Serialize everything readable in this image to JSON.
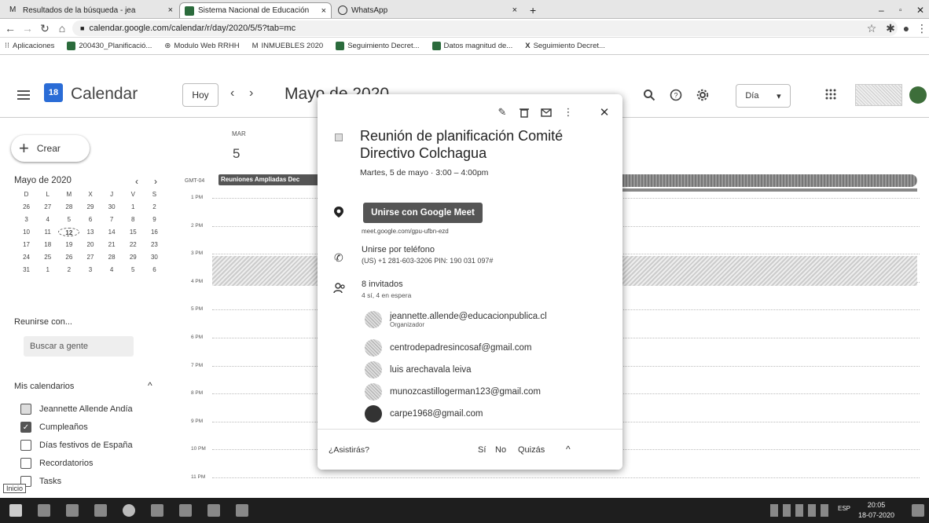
{
  "browser": {
    "tabs": [
      {
        "label": "Resultados de la búsqueda - jea",
        "close": "×"
      },
      {
        "label": "Sistema Nacional de Educación",
        "close": "×"
      },
      {
        "label": "WhatsApp",
        "close": "×"
      }
    ],
    "new_tab": "+",
    "url": "calendar.google.com/calendar/r/day/2020/5/5?tab=mc",
    "bookmarks": [
      "Aplicaciones",
      "200430_Planificació...",
      "Modulo Web RRHH",
      "INMUEBLES 2020",
      "Seguimiento Decret...",
      "Datos magnitud de...",
      "Seguimiento Decret..."
    ]
  },
  "header": {
    "logo_day": "18",
    "title": "Calendar",
    "today": "Hoy",
    "prev": "‹",
    "next": "›",
    "month": "Mayo de 2020",
    "view": "Día",
    "view_caret": "▾"
  },
  "sidebar": {
    "create": "Crear",
    "mini_month": "Mayo de 2020",
    "mini_prev": "‹",
    "mini_next": "›",
    "mini_days": [
      "D",
      "L",
      "M",
      "X",
      "J",
      "V",
      "S",
      "26",
      "27",
      "28",
      "29",
      "30",
      "1",
      "2",
      "3",
      "4",
      "5",
      "6",
      "7",
      "8",
      "9",
      "10",
      "11",
      "12",
      "13",
      "14",
      "15",
      "16",
      "17",
      "18",
      "19",
      "20",
      "21",
      "22",
      "23",
      "24",
      "25",
      "26",
      "27",
      "28",
      "29",
      "30",
      "31",
      "1",
      "2",
      "3",
      "4",
      "5",
      "6"
    ],
    "meet_with": "Reunirse con...",
    "search_people": "Buscar a gente",
    "my_calendars": "Mis calendarios",
    "my_calendars_caret": "^",
    "calendars": [
      {
        "name": "Jeannette Allende Andía",
        "checked": true
      },
      {
        "name": "Cumpleaños",
        "checked": true
      },
      {
        "name": "Días festivos de España",
        "checked": false
      },
      {
        "name": "Recordatorios",
        "checked": false
      },
      {
        "name": "Tasks",
        "checked": false
      }
    ],
    "tooltip": "Inicio"
  },
  "day": {
    "weekday": "MAR",
    "number": "5",
    "timezone": "GMT-04",
    "allday_event": "Reuniones Ampliadas Dec",
    "hours": [
      "1 PM",
      "2 PM",
      "3 PM",
      "4 PM",
      "5 PM",
      "6 PM",
      "7 PM",
      "8 PM",
      "9 PM",
      "10 PM",
      "11 PM"
    ]
  },
  "event": {
    "title": "Reunión de planificación Comité Directivo Colchagua",
    "time": "Martes, 5 de mayo · 3:00 – 4:00pm",
    "meet_button": "Unirse con Google Meet",
    "meet_link": "meet.google.com/gpu-ufbn-ezd",
    "phone_title": "Unirse por teléfono",
    "phone_info": "(US) +1 281-603-3206 PIN: 190 031 097#",
    "guest_count": "8 invitados",
    "guest_summary": "4 sí, 4 en espera",
    "guests": [
      {
        "name": "jeannette.allende@educacionpublica.cl",
        "role": "Organizador"
      },
      {
        "name": "centrodepadresincosaf@gmail.com",
        "role": ""
      },
      {
        "name": "luis arechavala leiva",
        "role": ""
      },
      {
        "name": "munozcastillogerman123@gmail.com",
        "role": ""
      },
      {
        "name": "carpe1968@gmail.com",
        "role": ""
      }
    ],
    "rsvp_question": "¿Asistirás?",
    "rsvp_yes": "Sí",
    "rsvp_no": "No",
    "rsvp_maybe": "Quizás",
    "rsvp_caret": "^"
  },
  "taskbar": {
    "lang": "ESP",
    "time": "20:05",
    "date": "18-07-2020"
  }
}
